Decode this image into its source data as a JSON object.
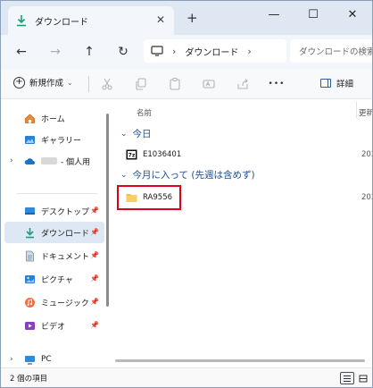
{
  "window": {
    "tab_title": "ダウンロード",
    "tab_close": "✕",
    "new_tab": "+",
    "minimize": "—",
    "maximize": "☐",
    "close": "✕"
  },
  "nav": {
    "back": "←",
    "forward": "→",
    "up": "↑",
    "refresh": "↻"
  },
  "address": {
    "separator": "›",
    "crumb": "ダウンロード",
    "end_separator": "›"
  },
  "search": {
    "placeholder": "ダウンロードの検索"
  },
  "commandbar": {
    "new_label": "新規作成",
    "new_chevron": "⌄",
    "more": "•••",
    "details_label": "詳細"
  },
  "sidebar": {
    "items": [
      {
        "label": "ホーム",
        "icon": "home-icon"
      },
      {
        "label": "ギャラリー",
        "icon": "gallery-icon"
      },
      {
        "label": "- 個人用",
        "icon": "onedrive-cloud-icon",
        "expander": "›"
      },
      {
        "label": "デスクトップ",
        "icon": "desktop-icon",
        "pinned": true
      },
      {
        "label": "ダウンロード",
        "icon": "download-icon",
        "pinned": true,
        "selected": true
      },
      {
        "label": "ドキュメント",
        "icon": "documents-icon",
        "pinned": true
      },
      {
        "label": "ピクチャ",
        "icon": "pictures-icon",
        "pinned": true
      },
      {
        "label": "ミュージック",
        "icon": "music-icon",
        "pinned": true
      },
      {
        "label": "ビデオ",
        "icon": "videos-icon",
        "pinned": true
      },
      {
        "label": "PC",
        "icon": "pc-icon",
        "expander": "›"
      }
    ],
    "pin_glyph": "📌"
  },
  "list": {
    "col_name": "名前",
    "col_modified": "更新",
    "groups": [
      {
        "label": "今日",
        "chevron": "⌄",
        "files": [
          {
            "name": "E1036401",
            "icon": "7z-archive-icon",
            "date": "202"
          }
        ]
      },
      {
        "label": "今月に入って (先週は含めず)",
        "chevron": "⌄",
        "files": [
          {
            "name": "RA9556",
            "icon": "folder-icon",
            "date": "202"
          }
        ]
      }
    ]
  },
  "status": {
    "text": "2 個の項目"
  },
  "colors": {
    "accent": "#1f5fb0",
    "highlight_box": "#e0001b",
    "folder": "#f4c04d",
    "group_header": "#1a4e91"
  }
}
